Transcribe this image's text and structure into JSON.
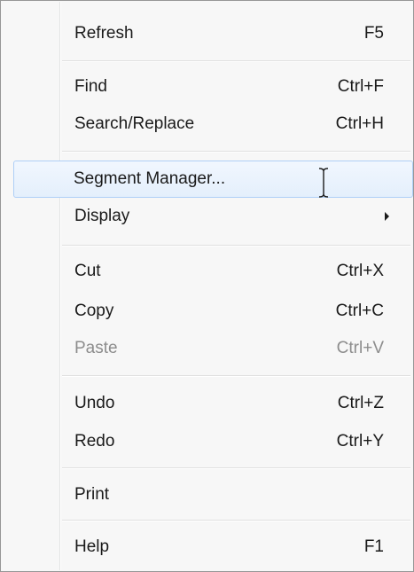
{
  "menu": {
    "items": [
      {
        "label": "Refresh",
        "shortcut": "F5"
      },
      {
        "label": "Find",
        "shortcut": "Ctrl+F"
      },
      {
        "label": "Search/Replace",
        "shortcut": "Ctrl+H"
      },
      {
        "label": "Segment Manager...",
        "shortcut": "",
        "highlighted": true
      },
      {
        "label": "Display",
        "shortcut": "",
        "submenu": true
      },
      {
        "label": "Cut",
        "shortcut": "Ctrl+X"
      },
      {
        "label": "Copy",
        "shortcut": "Ctrl+C"
      },
      {
        "label": "Paste",
        "shortcut": "Ctrl+V",
        "disabled": true
      },
      {
        "label": "Undo",
        "shortcut": "Ctrl+Z"
      },
      {
        "label": "Redo",
        "shortcut": "Ctrl+Y"
      },
      {
        "label": "Print",
        "shortcut": ""
      },
      {
        "label": "Help",
        "shortcut": "F1"
      }
    ]
  },
  "icons": {
    "submenu": "chevron-right-icon",
    "cursor": "text-cursor-icon"
  },
  "colors": {
    "highlight_border": "#aecff7",
    "highlight_fill": "#e4effc",
    "disabled_text": "#8d8d8d"
  }
}
